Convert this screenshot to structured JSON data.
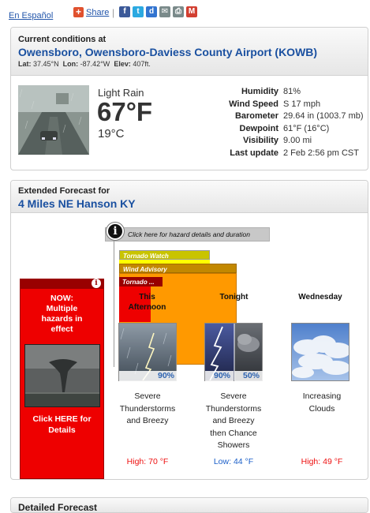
{
  "top": {
    "lang_link": "En Español",
    "share_label": "Share",
    "share_icons": [
      "facebook-icon",
      "twitter-icon",
      "delicious-icon",
      "email-icon",
      "print-icon",
      "gmail-icon"
    ]
  },
  "current": {
    "header_label": "Current conditions at",
    "station": "Owensboro, Owensboro-Daviess County Airport (KOWB)",
    "lat_label": "Lat:",
    "lat": "37.45°N",
    "lon_label": "Lon:",
    "lon": "-87.42°W",
    "elev_label": "Elev:",
    "elev": "407ft.",
    "condition": "Light Rain",
    "temp_f": "67°F",
    "temp_c": "19°C",
    "details": [
      {
        "label": "Humidity",
        "value": "81%"
      },
      {
        "label": "Wind Speed",
        "value": "S 17 mph"
      },
      {
        "label": "Barometer",
        "value": "29.64 in (1003.7 mb)"
      },
      {
        "label": "Dewpoint",
        "value": "61°F (16°C)"
      },
      {
        "label": "Visibility",
        "value": "9.00 mi"
      },
      {
        "label": "Last update",
        "value": "2 Feb 2:56 pm CST"
      }
    ]
  },
  "extended": {
    "header_label": "Extended Forecast for",
    "location": "4 Miles NE Hanson KY",
    "hazard_bar_text": "Click here for hazard details and duration",
    "now": {
      "title_line1": "NOW:",
      "title_line2": "Multiple",
      "title_line3": "hazards in",
      "title_line4": "effect",
      "link_line1": "Click HERE for",
      "link_line2": "Details"
    },
    "hazards": {
      "tornado_watch": "Tornado Watch",
      "wind_advisory": "Wind Advisory",
      "tornado_warning": "Tornado ..."
    },
    "periods": [
      {
        "name_line1": "This",
        "name_line2": "Afternoon",
        "pop": "90%",
        "desc": [
          "Severe",
          "Thunderstorms",
          "and Breezy"
        ],
        "temp_label": "High: 70 °F",
        "temp_type": "high"
      },
      {
        "name_line1": "Tonight",
        "name_line2": "",
        "pop": "90%",
        "pop2": "50%",
        "desc": [
          "Severe",
          "Thunderstorms",
          "and Breezy",
          "then Chance",
          "Showers"
        ],
        "temp_label": "Low: 44 °F",
        "temp_type": "low"
      },
      {
        "name_line1": "Wednesday",
        "name_line2": "",
        "pop": "",
        "desc": [
          "Increasing",
          "Clouds"
        ],
        "temp_label": "High: 49 °F",
        "temp_type": "high"
      }
    ]
  },
  "detailed": {
    "header_label": "Detailed Forecast"
  },
  "colors": {
    "link_blue": "#1a50a0",
    "warning_red": "#ee0000",
    "advisory_orange": "#ff9900",
    "watch_yellow": "#ffff00",
    "high_red": "#ee1111",
    "low_blue": "#1a5ec8"
  }
}
